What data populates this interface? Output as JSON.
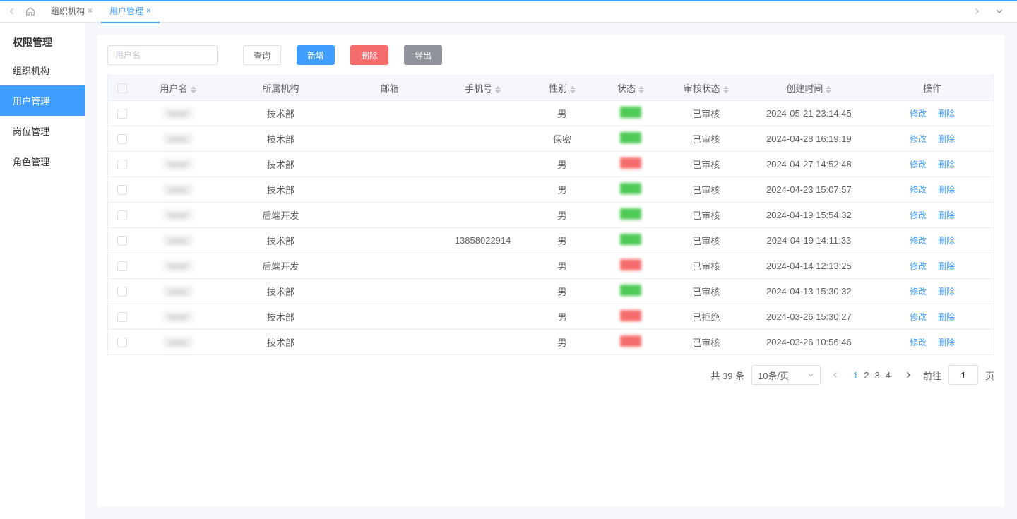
{
  "tabs": {
    "home_title": "首页",
    "items": [
      {
        "label": "组织机构",
        "active": false
      },
      {
        "label": "用户管理",
        "active": true
      }
    ]
  },
  "sidebar": {
    "title": "权限管理",
    "items": [
      {
        "label": "组织机构"
      },
      {
        "label": "用户管理"
      },
      {
        "label": "岗位管理"
      },
      {
        "label": "角色管理"
      }
    ],
    "active_index": 1
  },
  "toolbar": {
    "search_placeholder": "用户名",
    "query_label": "查询",
    "add_label": "新增",
    "delete_label": "删除",
    "export_label": "导出"
  },
  "table": {
    "headers": {
      "username": "用户名",
      "dept": "所属机构",
      "email": "邮箱",
      "phone": "手机号",
      "gender": "性别",
      "status": "状态",
      "audit": "审核状态",
      "created": "创建时间",
      "action": "操作"
    },
    "rows": [
      {
        "dept": "技术部",
        "phone": "",
        "gender": "男",
        "status": "green",
        "audit": "已审核",
        "created": "2024-05-21 23:14:45"
      },
      {
        "dept": "技术部",
        "phone": "",
        "gender": "保密",
        "status": "green",
        "audit": "已审核",
        "created": "2024-04-28 16:19:19"
      },
      {
        "dept": "技术部",
        "phone": "",
        "gender": "男",
        "status": "red",
        "audit": "已审核",
        "created": "2024-04-27 14:52:48"
      },
      {
        "dept": "技术部",
        "phone": "",
        "gender": "男",
        "status": "green",
        "audit": "已审核",
        "created": "2024-04-23 15:07:57"
      },
      {
        "dept": "后端开发",
        "phone": "",
        "gender": "男",
        "status": "green",
        "audit": "已审核",
        "created": "2024-04-19 15:54:32"
      },
      {
        "dept": "技术部",
        "phone": "13858022914",
        "gender": "男",
        "status": "green",
        "audit": "已审核",
        "created": "2024-04-19 14:11:33"
      },
      {
        "dept": "后端开发",
        "phone": "",
        "gender": "男",
        "status": "red",
        "audit": "已审核",
        "created": "2024-04-14 12:13:25"
      },
      {
        "dept": "技术部",
        "phone": "",
        "gender": "男",
        "status": "green",
        "audit": "已审核",
        "created": "2024-04-13 15:30:32"
      },
      {
        "dept": "技术部",
        "phone": "",
        "gender": "男",
        "status": "red",
        "audit": "已拒绝",
        "created": "2024-03-26 15:30:27"
      },
      {
        "dept": "技术部",
        "phone": "",
        "gender": "男",
        "status": "red",
        "audit": "已审核",
        "created": "2024-03-26 10:56:46"
      }
    ],
    "action_edit": "修改",
    "action_delete": "删除"
  },
  "pagination": {
    "total_label_prefix": "共 ",
    "total": "39",
    "total_label_suffix": " 条",
    "page_size": "10条/页",
    "pages": [
      "1",
      "2",
      "3",
      "4"
    ],
    "active_page": 1,
    "goto_label": "前往",
    "goto_value": "1",
    "goto_suffix": "页"
  }
}
